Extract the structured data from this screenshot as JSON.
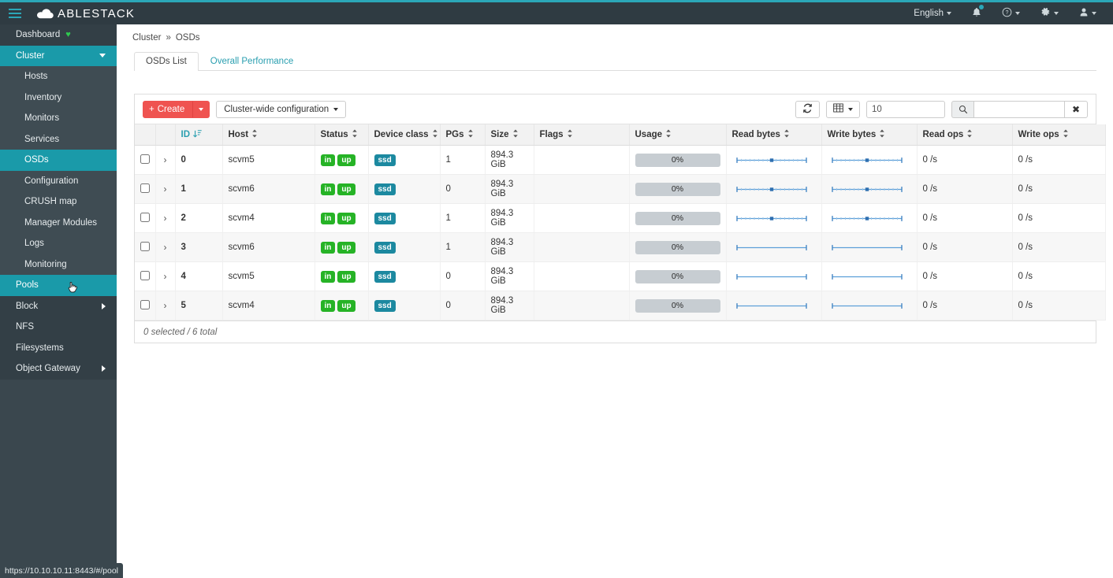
{
  "brand": {
    "name": "ABLESTACK",
    "logo_icon": "cloud-icon",
    "menu_icon": "hamburger-icon"
  },
  "colors": {
    "accent_teal": "#1a9aa9",
    "navbar": "#2f3b42",
    "sidebar": "#3a474e",
    "create_red": "#ef5350",
    "badge_green": "#26b326",
    "badge_teal": "#1c89a0",
    "link_teal": "#2a9fb0",
    "spark_blue": "#3d8fd1"
  },
  "navbar": {
    "language": "English",
    "language_caret_icon": "chevron-down-icon",
    "notifications_icon": "bell-icon",
    "notifications_badge": "",
    "help_icon": "help-circle-icon",
    "help_caret_icon": "chevron-down-icon",
    "settings_icon": "gear-icon",
    "settings_caret_icon": "chevron-down-icon",
    "user_icon": "user-icon",
    "user_caret_icon": "chevron-down-icon"
  },
  "sidebar": {
    "items": [
      {
        "label": "Dashboard",
        "level": 0,
        "state": "normal",
        "icon": "heart-icon",
        "chevron": ""
      },
      {
        "label": "Cluster",
        "level": 0,
        "state": "expanded-active",
        "icon": "",
        "chevron": "chevron-down-icon"
      },
      {
        "label": "Hosts",
        "level": 1,
        "state": "normal",
        "icon": "",
        "chevron": ""
      },
      {
        "label": "Inventory",
        "level": 1,
        "state": "normal",
        "icon": "",
        "chevron": ""
      },
      {
        "label": "Monitors",
        "level": 1,
        "state": "normal",
        "icon": "",
        "chevron": ""
      },
      {
        "label": "Services",
        "level": 1,
        "state": "normal",
        "icon": "",
        "chevron": ""
      },
      {
        "label": "OSDs",
        "level": 1,
        "state": "active",
        "icon": "",
        "chevron": ""
      },
      {
        "label": "Configuration",
        "level": 1,
        "state": "normal",
        "icon": "",
        "chevron": ""
      },
      {
        "label": "CRUSH map",
        "level": 1,
        "state": "normal",
        "icon": "",
        "chevron": ""
      },
      {
        "label": "Manager Modules",
        "level": 1,
        "state": "normal",
        "icon": "",
        "chevron": ""
      },
      {
        "label": "Logs",
        "level": 1,
        "state": "normal",
        "icon": "",
        "chevron": ""
      },
      {
        "label": "Monitoring",
        "level": 1,
        "state": "normal",
        "icon": "",
        "chevron": ""
      },
      {
        "label": "Pools",
        "level": 0,
        "state": "hover-active",
        "icon": "",
        "chevron": ""
      },
      {
        "label": "Block",
        "level": 0,
        "state": "normal",
        "icon": "",
        "chevron": "chevron-right-icon"
      },
      {
        "label": "NFS",
        "level": 0,
        "state": "normal",
        "icon": "",
        "chevron": ""
      },
      {
        "label": "Filesystems",
        "level": 0,
        "state": "normal",
        "icon": "",
        "chevron": ""
      },
      {
        "label": "Object Gateway",
        "level": 0,
        "state": "normal",
        "icon": "",
        "chevron": "chevron-right-icon"
      }
    ]
  },
  "status_bar": {
    "url": "https://10.10.10.11:8443/#/pool"
  },
  "breadcrumb": {
    "items": [
      "Cluster",
      "OSDs"
    ],
    "separator": "»"
  },
  "tabs": [
    {
      "label": "OSDs List",
      "active": true
    },
    {
      "label": "Overall Performance",
      "active": false
    }
  ],
  "toolbar": {
    "create_label": "Create",
    "create_icon": "plus-icon",
    "create_caret_icon": "chevron-down-icon",
    "config_label": "Cluster-wide configuration",
    "config_caret_icon": "chevron-down-icon",
    "refresh_icon": "refresh-icon",
    "columns_icon": "table-icon",
    "columns_caret_icon": "chevron-down-icon",
    "limit_value": "10",
    "search_icon": "search-icon",
    "search_value": "",
    "search_clear_icon": "close-icon"
  },
  "table": {
    "columns": [
      {
        "key": "select",
        "label": "",
        "sortable": false,
        "sorted": false
      },
      {
        "key": "expand",
        "label": "",
        "sortable": false,
        "sorted": false
      },
      {
        "key": "id",
        "label": "ID",
        "sortable": true,
        "sorted": true
      },
      {
        "key": "host",
        "label": "Host",
        "sortable": true,
        "sorted": false
      },
      {
        "key": "status",
        "label": "Status",
        "sortable": true,
        "sorted": false
      },
      {
        "key": "device_class",
        "label": "Device class",
        "sortable": true,
        "sorted": false
      },
      {
        "key": "pgs",
        "label": "PGs",
        "sortable": true,
        "sorted": false
      },
      {
        "key": "size",
        "label": "Size",
        "sortable": true,
        "sorted": false
      },
      {
        "key": "flags",
        "label": "Flags",
        "sortable": true,
        "sorted": false
      },
      {
        "key": "usage",
        "label": "Usage",
        "sortable": true,
        "sorted": false
      },
      {
        "key": "read_bytes",
        "label": "Read bytes",
        "sortable": true,
        "sorted": false
      },
      {
        "key": "write_bytes",
        "label": "Write bytes",
        "sortable": true,
        "sorted": false
      },
      {
        "key": "read_ops",
        "label": "Read ops",
        "sortable": true,
        "sorted": false
      },
      {
        "key": "write_ops",
        "label": "Write ops",
        "sortable": true,
        "sorted": false
      }
    ],
    "rows": [
      {
        "selected": false,
        "id": "0",
        "host": "scvm5",
        "status": [
          "in",
          "up"
        ],
        "device_class": "ssd",
        "pgs": "1",
        "size": "894.3 GiB",
        "flags": "",
        "usage": "0%",
        "read_bytes_spark": "flat-with-marker",
        "write_bytes_spark": "flat-with-marker",
        "read_ops": "0 /s",
        "write_ops": "0 /s"
      },
      {
        "selected": false,
        "id": "1",
        "host": "scvm6",
        "status": [
          "in",
          "up"
        ],
        "device_class": "ssd",
        "pgs": "0",
        "size": "894.3 GiB",
        "flags": "",
        "usage": "0%",
        "read_bytes_spark": "flat-with-marker",
        "write_bytes_spark": "flat-with-marker",
        "read_ops": "0 /s",
        "write_ops": "0 /s"
      },
      {
        "selected": false,
        "id": "2",
        "host": "scvm4",
        "status": [
          "in",
          "up"
        ],
        "device_class": "ssd",
        "pgs": "1",
        "size": "894.3 GiB",
        "flags": "",
        "usage": "0%",
        "read_bytes_spark": "flat-with-marker",
        "write_bytes_spark": "flat-with-marker",
        "read_ops": "0 /s",
        "write_ops": "0 /s"
      },
      {
        "selected": false,
        "id": "3",
        "host": "scvm6",
        "status": [
          "in",
          "up"
        ],
        "device_class": "ssd",
        "pgs": "1",
        "size": "894.3 GiB",
        "flags": "",
        "usage": "0%",
        "read_bytes_spark": "flat",
        "write_bytes_spark": "flat",
        "read_ops": "0 /s",
        "write_ops": "0 /s"
      },
      {
        "selected": false,
        "id": "4",
        "host": "scvm5",
        "status": [
          "in",
          "up"
        ],
        "device_class": "ssd",
        "pgs": "0",
        "size": "894.3 GiB",
        "flags": "",
        "usage": "0%",
        "read_bytes_spark": "flat",
        "write_bytes_spark": "flat",
        "read_ops": "0 /s",
        "write_ops": "0 /s"
      },
      {
        "selected": false,
        "id": "5",
        "host": "scvm4",
        "status": [
          "in",
          "up"
        ],
        "device_class": "ssd",
        "pgs": "0",
        "size": "894.3 GiB",
        "flags": "",
        "usage": "0%",
        "read_bytes_spark": "flat",
        "write_bytes_spark": "flat",
        "read_ops": "0 /s",
        "write_ops": "0 /s"
      }
    ],
    "footer": "0 selected / 6 total"
  }
}
